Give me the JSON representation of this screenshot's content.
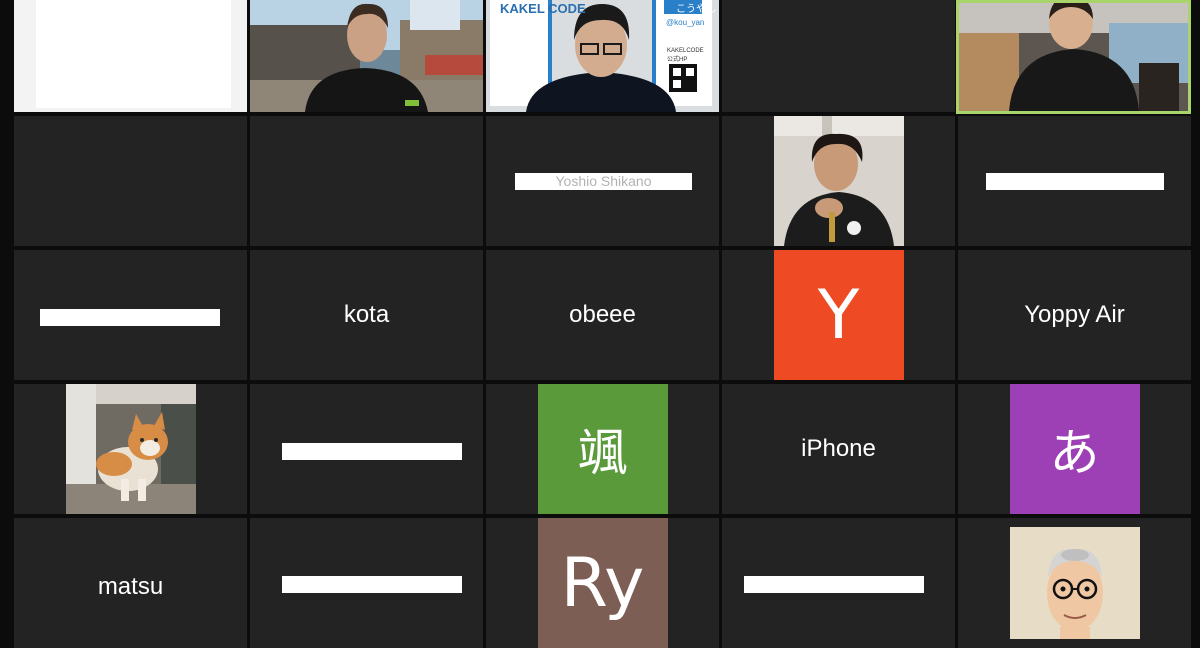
{
  "meeting": {
    "view": "gallery",
    "participants": [
      {
        "name": "",
        "type": "video",
        "description": "blank-white-video"
      },
      {
        "name": "",
        "type": "video",
        "description": "man-in-black-shirt-virtual-background"
      },
      {
        "name": "",
        "type": "video",
        "description": "man-with-glasses-kakel-code-background"
      },
      {
        "name": "",
        "type": "empty"
      },
      {
        "name": "",
        "type": "video",
        "active_speaker": true
      },
      {
        "name": "",
        "type": "empty"
      },
      {
        "name": "",
        "type": "empty"
      },
      {
        "name": "Yoshio Shikano",
        "type": "redacted-name"
      },
      {
        "name": "",
        "type": "photo",
        "description": "young-man-photo"
      },
      {
        "name": "",
        "type": "redacted-name"
      },
      {
        "name": "",
        "type": "redacted-name"
      },
      {
        "name": "kota",
        "type": "name"
      },
      {
        "name": "obeee",
        "type": "name"
      },
      {
        "name": "",
        "type": "avatar",
        "initial": "Y",
        "color": "#ee4a24"
      },
      {
        "name": "Yoppy Air",
        "type": "name"
      },
      {
        "name": "",
        "type": "photo",
        "description": "kitten-photo"
      },
      {
        "name": "",
        "type": "redacted-name"
      },
      {
        "name": "",
        "type": "avatar",
        "initial": "颯",
        "color": "#5a9a3b"
      },
      {
        "name": "iPhone",
        "type": "name"
      },
      {
        "name": "",
        "type": "avatar",
        "initial": "あ",
        "color": "#9d40b5"
      },
      {
        "name": "matsu",
        "type": "name"
      },
      {
        "name": "",
        "type": "redacted-name"
      },
      {
        "name": "",
        "type": "avatar",
        "initial": "Ry",
        "color": "#7d5e54"
      },
      {
        "name": "",
        "type": "redacted-name"
      },
      {
        "name": "",
        "type": "photo",
        "description": "cartoon-bald-man-glasses-avatar"
      }
    ]
  },
  "labels": {
    "kota": "kota",
    "obeee": "obeee",
    "yoppy": "Yoppy Air",
    "iphone": "iPhone",
    "matsu": "matsu",
    "avatar_y": "Y",
    "avatar_kanji": "颯",
    "avatar_a": "あ",
    "avatar_ry": "Ry",
    "kakel_code": "KAKEL CODE",
    "kakel_handle": "@kou_yan",
    "kakel_kana": "こうやん",
    "kakel_qr_label": "KAKELCODE 公式HP"
  },
  "colors": {
    "tile_bg": "#232323",
    "grid_bg": "#0c0c0c",
    "active_border": "#a9d36b",
    "avatar_y": "#ee4a24",
    "avatar_kanji": "#5a9a3b",
    "avatar_a": "#9d40b5",
    "avatar_ry": "#7d5e54"
  }
}
